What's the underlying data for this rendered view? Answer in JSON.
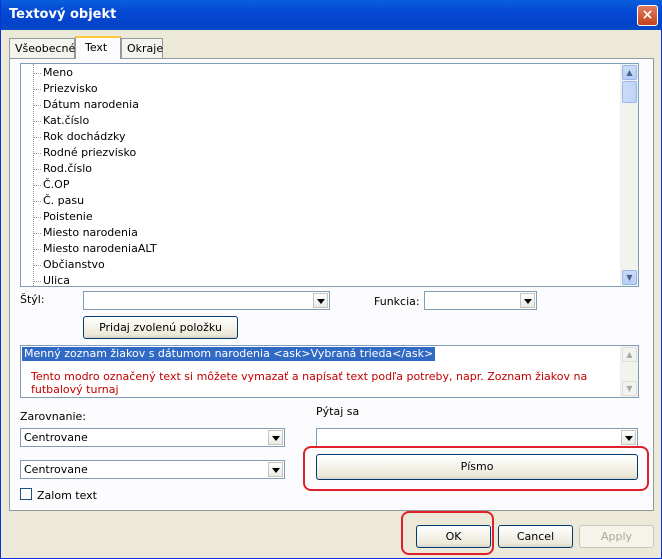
{
  "window": {
    "title": "Textový objekt",
    "close_label": "×"
  },
  "tabs": [
    {
      "label": "Všeobecné"
    },
    {
      "label": "Text"
    },
    {
      "label": "Okraje"
    }
  ],
  "fields_list": {
    "items": [
      "Meno",
      "Priezvisko",
      "Dátum narodenia",
      "Kat.číslo",
      "Rok dochádzky",
      "Rodné priezvisko",
      "Rod.číslo",
      "Č.OP",
      "Č. pasu",
      "Poistenie",
      "Miesto narodenia",
      "Miesto narodeniaALT",
      "Občianstvo",
      "Ulica"
    ]
  },
  "style": {
    "label": "Štýl:",
    "value": ""
  },
  "function": {
    "label": "Funkcia:",
    "value": ""
  },
  "add_button": {
    "label": "Pridaj zvolenú položku"
  },
  "text_area": {
    "selected_text": "Menný zoznam žiakov s dátumom narodenia <ask>Vybraná trieda</ask>",
    "hint_text": "Tento modro označený text si môžete vymazať a napísať text podľa potreby, napr. Zoznam žiakov na futbalový turnaj"
  },
  "alignment": {
    "label": "Zarovnanie:",
    "value1": "Centrovane",
    "value2": "Centrovane"
  },
  "ask": {
    "label": "Pýtaj sa",
    "value": ""
  },
  "font_button": {
    "label": "Písmo"
  },
  "wrap_checkbox": {
    "label": "Zalom text",
    "checked": false
  },
  "buttons": {
    "ok": "OK",
    "cancel": "Cancel",
    "apply": "Apply"
  },
  "highlight_color": "#e0202a"
}
